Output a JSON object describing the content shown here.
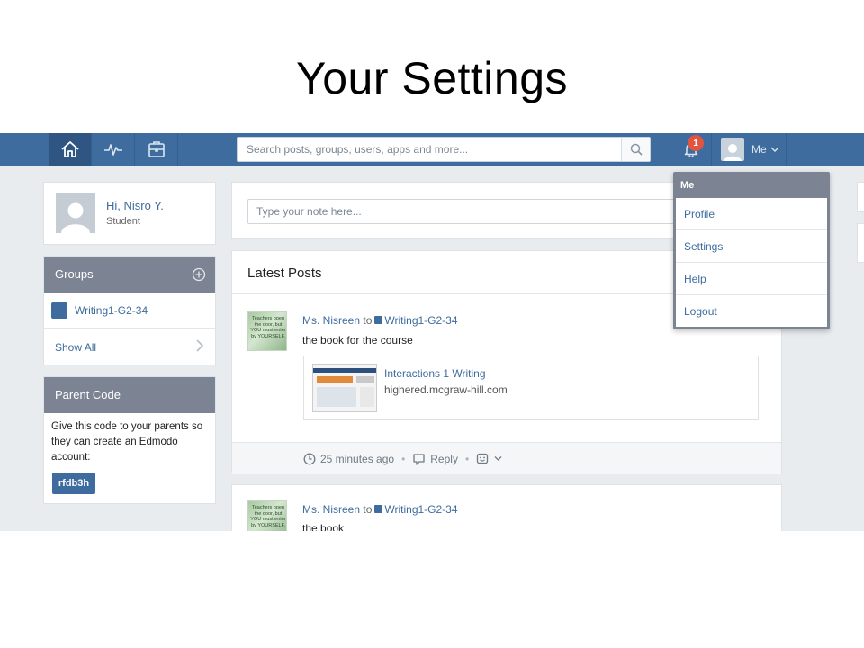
{
  "slide": {
    "title": "Your Settings"
  },
  "navbar": {
    "search_placeholder": "Search posts, groups, users, apps and more...",
    "notification_count": "1",
    "me_label": "Me"
  },
  "profile": {
    "name": "Hi, Nisro Y.",
    "role": "Student"
  },
  "groups": {
    "title": "Groups",
    "items": [
      {
        "name": "Writing1-G2-34"
      }
    ],
    "show_all": "Show All"
  },
  "parent_code": {
    "title": "Parent Code",
    "text": "Give this code to your parents so they can create an Edmodo account:",
    "code": "rfdb3h"
  },
  "note": {
    "placeholder": "Type your note here..."
  },
  "posts": {
    "title": "Latest Posts",
    "items": [
      {
        "author": "Ms. Nisreen",
        "to": "to",
        "group": "Writing1-G2-34",
        "body": "the book for the course",
        "thumb_text": "Teachers open the door, but YOU must enter by YOURSELF.",
        "link_title": "Interactions 1 Writing",
        "link_domain": "highered.mcgraw-hill.com",
        "time": "25 minutes ago",
        "reply": "Reply"
      },
      {
        "author": "Ms. Nisreen",
        "to": "to",
        "group": "Writing1-G2-34",
        "body": "the book",
        "thumb_text": "Teachers open the door, but YOU must enter by YOURSELF."
      }
    ]
  },
  "dropdown": {
    "header": "Me",
    "items": [
      "Profile",
      "Settings",
      "Help",
      "Logout"
    ]
  },
  "colors": {
    "nav": "#3e6c9e",
    "panel_header": "#7c8494",
    "link": "#3e6c9e"
  }
}
